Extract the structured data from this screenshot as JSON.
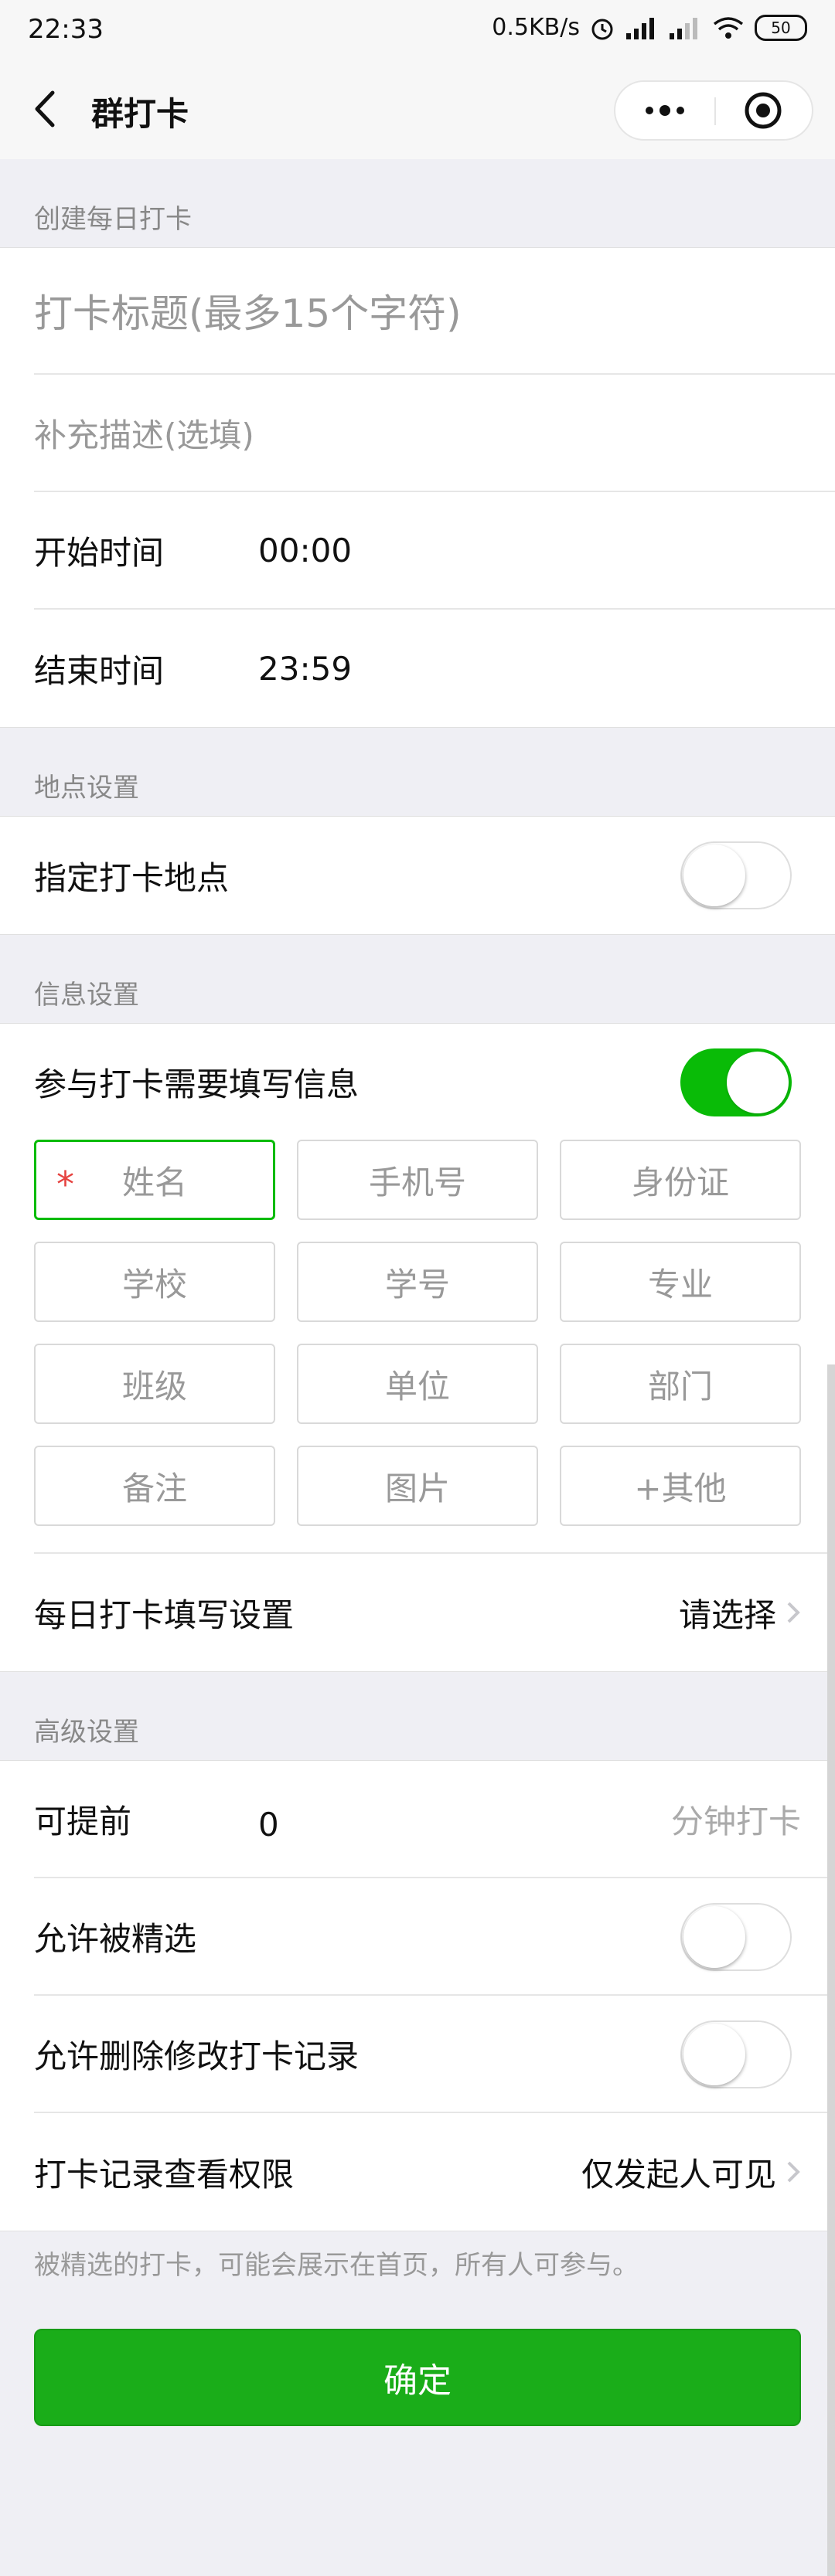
{
  "status_bar": {
    "time": "22:33",
    "speed": "0.5KB/s",
    "battery": "50"
  },
  "navbar": {
    "title": "群打卡"
  },
  "sections": {
    "create": "创建每日打卡",
    "location": "地点设置",
    "info": "信息设置",
    "advanced": "高级设置"
  },
  "create": {
    "title_placeholder": "打卡标题(最多15个字符)",
    "desc_placeholder": "补充描述(选填)",
    "start_label": "开始时间",
    "start_value": "00:00",
    "end_label": "结束时间",
    "end_value": "23:59"
  },
  "location": {
    "label": "指定打卡地点",
    "enabled": false
  },
  "info": {
    "require_label": "参与打卡需要填写信息",
    "enabled": true,
    "tags": [
      {
        "label": "姓名",
        "selected": true,
        "required": true
      },
      {
        "label": "手机号",
        "selected": false
      },
      {
        "label": "身份证",
        "selected": false
      },
      {
        "label": "学校",
        "selected": false
      },
      {
        "label": "学号",
        "selected": false
      },
      {
        "label": "专业",
        "selected": false
      },
      {
        "label": "班级",
        "selected": false
      },
      {
        "label": "单位",
        "selected": false
      },
      {
        "label": "部门",
        "selected": false
      },
      {
        "label": "备注",
        "selected": false
      },
      {
        "label": "图片",
        "selected": false
      },
      {
        "label": "+其他",
        "selected": false
      }
    ],
    "required_mark": "*",
    "daily_label": "每日打卡填写设置",
    "daily_value": "请选择"
  },
  "advanced": {
    "advance_label": "可提前",
    "advance_value": "0",
    "advance_unit": "分钟打卡",
    "featured_label": "允许被精选",
    "featured_enabled": false,
    "delete_label": "允许删除修改打卡记录",
    "delete_enabled": false,
    "permission_label": "打卡记录查看权限",
    "permission_value": "仅发起人可见"
  },
  "note": "被精选的打卡，可能会展示在首页，所有人可参与。",
  "confirm_label": "确定",
  "colors": {
    "accent": "#09bb07",
    "button": "#1aad19",
    "required": "#e64340"
  }
}
